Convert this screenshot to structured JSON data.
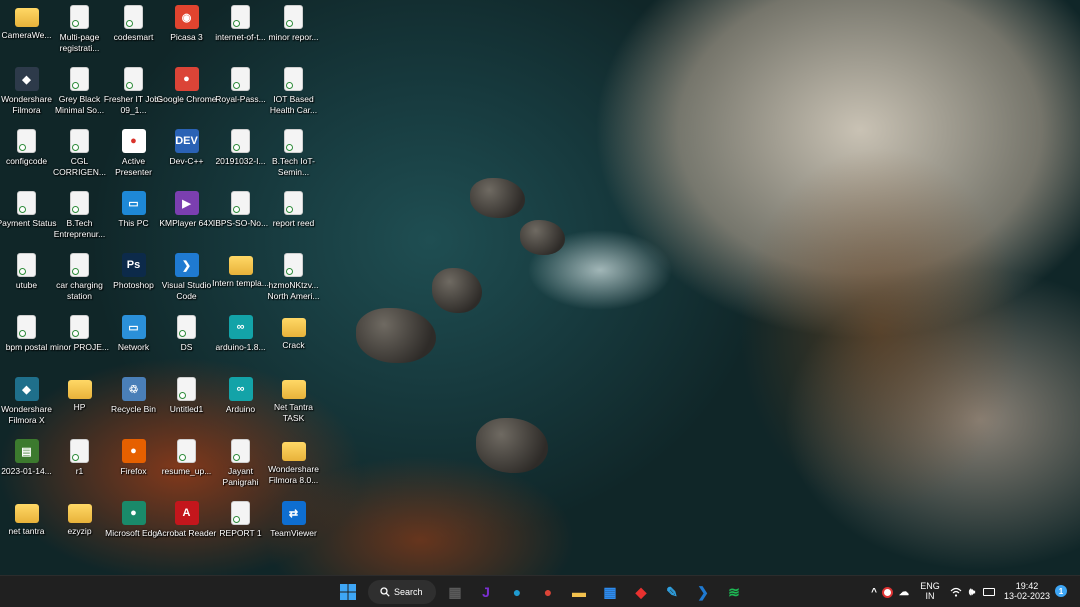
{
  "desktop_icons": [
    {
      "label": "CameraWe...",
      "type": "folder",
      "col": 0,
      "row": 0
    },
    {
      "label": "Multi-page registrati...",
      "type": "file",
      "col": 1,
      "row": 0
    },
    {
      "label": "codesmart",
      "type": "file",
      "col": 2,
      "row": 0
    },
    {
      "label": "Picasa 3",
      "type": "app",
      "col": 3,
      "row": 0,
      "color": "#e0442f",
      "glyph": "◉"
    },
    {
      "label": "internet-of-t...",
      "type": "file",
      "col": 4,
      "row": 0
    },
    {
      "label": "minor repor...",
      "type": "file",
      "col": 5,
      "row": 0
    },
    {
      "label": "Wondershare Filmora",
      "type": "app",
      "col": 0,
      "row": 1,
      "color": "#2d3a4a",
      "glyph": "◆"
    },
    {
      "label": "Grey Black Minimal So...",
      "type": "file",
      "col": 1,
      "row": 1
    },
    {
      "label": "Fresher IT Jobs 09_1...",
      "type": "file",
      "col": 2,
      "row": 1
    },
    {
      "label": "Google Chrome",
      "type": "app",
      "col": 3,
      "row": 1,
      "color": "#db4437",
      "glyph": "●"
    },
    {
      "label": "Royal-Pass...",
      "type": "file",
      "col": 4,
      "row": 1
    },
    {
      "label": "IOT Based Health Car...",
      "type": "file",
      "col": 5,
      "row": 1
    },
    {
      "label": "configcode",
      "type": "file",
      "col": 0,
      "row": 2
    },
    {
      "label": "CGL CORRIGEN...",
      "type": "file",
      "col": 1,
      "row": 2
    },
    {
      "label": "Active Presenter",
      "type": "app",
      "col": 2,
      "row": 2,
      "color": "#ffffff",
      "glyph": "●"
    },
    {
      "label": "Dev-C++",
      "type": "app",
      "col": 3,
      "row": 2,
      "color": "#2a62b5",
      "glyph": "DEV"
    },
    {
      "label": "20191032-I...",
      "type": "file",
      "col": 4,
      "row": 2
    },
    {
      "label": "B.Tech IoT-Semin...",
      "type": "file",
      "col": 5,
      "row": 2
    },
    {
      "label": "Payment Status",
      "type": "file",
      "col": 0,
      "row": 3
    },
    {
      "label": "B.Tech Entreprenur...",
      "type": "file",
      "col": 1,
      "row": 3
    },
    {
      "label": "This PC",
      "type": "app",
      "col": 2,
      "row": 3,
      "color": "#1e88d6",
      "glyph": "▭"
    },
    {
      "label": "KMPlayer 64X",
      "type": "app",
      "col": 3,
      "row": 3,
      "color": "#7b3fb0",
      "glyph": "▶"
    },
    {
      "label": "IBPS-SO-No...",
      "type": "file",
      "col": 4,
      "row": 3
    },
    {
      "label": "report reed",
      "type": "file",
      "col": 5,
      "row": 3
    },
    {
      "label": "utube",
      "type": "file",
      "col": 0,
      "row": 4
    },
    {
      "label": "car charging station",
      "type": "file",
      "col": 1,
      "row": 4
    },
    {
      "label": "Photoshop",
      "type": "app",
      "col": 2,
      "row": 4,
      "color": "#0c2a4a",
      "glyph": "Ps"
    },
    {
      "label": "Visual Studio Code",
      "type": "app",
      "col": 3,
      "row": 4,
      "color": "#1f7ad1",
      "glyph": "❯"
    },
    {
      "label": "Intern templa...",
      "type": "folder",
      "col": 4,
      "row": 4
    },
    {
      "label": "hzmoNKtzv... North Ameri...",
      "type": "file",
      "col": 5,
      "row": 4
    },
    {
      "label": "bpm postal",
      "type": "file",
      "col": 0,
      "row": 5
    },
    {
      "label": "minor PROJE...",
      "type": "file",
      "col": 1,
      "row": 5
    },
    {
      "label": "Network",
      "type": "app",
      "col": 2,
      "row": 5,
      "color": "#2b90d9",
      "glyph": "▭"
    },
    {
      "label": "DS",
      "type": "file",
      "col": 3,
      "row": 5
    },
    {
      "label": "arduino-1.8...",
      "type": "app",
      "col": 4,
      "row": 5,
      "color": "#13a3a8",
      "glyph": "∞"
    },
    {
      "label": "Crack",
      "type": "folder",
      "col": 5,
      "row": 5
    },
    {
      "label": "Wondershare Filmora X",
      "type": "app",
      "col": 0,
      "row": 6,
      "color": "#1f6f8b",
      "glyph": "◆"
    },
    {
      "label": "HP",
      "type": "folder",
      "col": 1,
      "row": 6
    },
    {
      "label": "Recycle Bin",
      "type": "app",
      "col": 2,
      "row": 6,
      "color": "#4a7fb8",
      "glyph": "♲"
    },
    {
      "label": "Untitled1",
      "type": "file",
      "col": 3,
      "row": 6
    },
    {
      "label": "Arduino",
      "type": "app",
      "col": 4,
      "row": 6,
      "color": "#13a3a8",
      "glyph": "∞"
    },
    {
      "label": "Net Tantra TASK",
      "type": "folder",
      "col": 5,
      "row": 6
    },
    {
      "label": "2023-01-14...",
      "type": "app",
      "col": 0,
      "row": 7,
      "color": "#3c7a2e",
      "glyph": "▤"
    },
    {
      "label": "r1",
      "type": "file",
      "col": 1,
      "row": 7
    },
    {
      "label": "Firefox",
      "type": "app",
      "col": 2,
      "row": 7,
      "color": "#e66000",
      "glyph": "●"
    },
    {
      "label": "resume_up...",
      "type": "file",
      "col": 3,
      "row": 7
    },
    {
      "label": "Jayant Panigrahi",
      "type": "file",
      "col": 4,
      "row": 7
    },
    {
      "label": "Wondershare Filmora 8.0...",
      "type": "folder",
      "col": 5,
      "row": 7
    },
    {
      "label": "net tantra",
      "type": "folder",
      "col": 0,
      "row": 8
    },
    {
      "label": "ezyzip",
      "type": "folder",
      "col": 1,
      "row": 8
    },
    {
      "label": "Microsoft Edge",
      "type": "app",
      "col": 2,
      "row": 8,
      "color": "#1a8a6a",
      "glyph": "●"
    },
    {
      "label": "Acrobat Reader",
      "type": "app",
      "col": 3,
      "row": 8,
      "color": "#c4161c",
      "glyph": "A"
    },
    {
      "label": "REPORT 1",
      "type": "file",
      "col": 4,
      "row": 8
    },
    {
      "label": "TeamViewer",
      "type": "app",
      "col": 5,
      "row": 8,
      "color": "#0e6ed1",
      "glyph": "⇄"
    }
  ],
  "taskbar": {
    "search_label": "Search",
    "pinned": [
      {
        "name": "file-manager",
        "glyph": "▦",
        "color": "#5a5a5a"
      },
      {
        "name": "jetbrains",
        "glyph": "J",
        "color": "#7a2fd1"
      },
      {
        "name": "edge",
        "glyph": "●",
        "color": "#1f9bd1"
      },
      {
        "name": "chrome",
        "glyph": "●",
        "color": "#db4437"
      },
      {
        "name": "file-explorer",
        "glyph": "▬",
        "color": "#f2c14e"
      },
      {
        "name": "microsoft-store",
        "glyph": "▦",
        "color": "#2d8cf0"
      },
      {
        "name": "anydesk",
        "glyph": "◆",
        "color": "#e8312f"
      },
      {
        "name": "settings",
        "glyph": "✎",
        "color": "#2fa0e0"
      },
      {
        "name": "vscode",
        "glyph": "❯",
        "color": "#1f7ad1"
      },
      {
        "name": "spotify",
        "glyph": "≋",
        "color": "#1db954"
      }
    ],
    "language_top": "ENG",
    "language_bottom": "IN",
    "time": "19:42",
    "date": "13-02-2023",
    "notification_count": "1"
  }
}
